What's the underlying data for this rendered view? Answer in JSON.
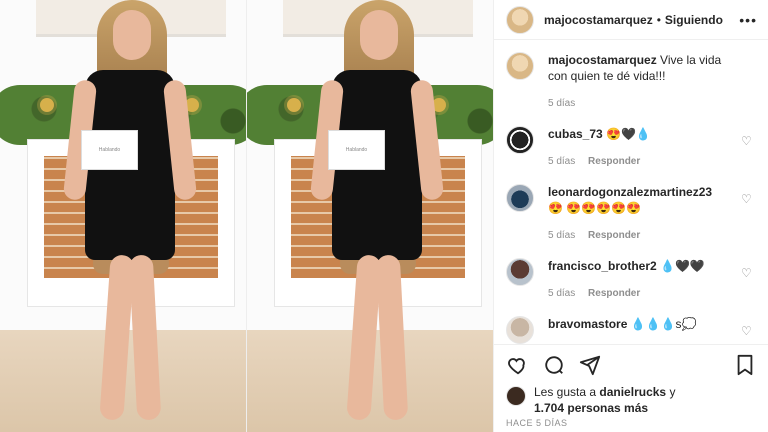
{
  "post": {
    "username": "majocostamarquez",
    "follow_label": "Siguiendo",
    "separator": "•",
    "more": "•••",
    "caption": {
      "user": "majocostamarquez",
      "text": "Vive la vida con quien te dé vida!!!",
      "time": "5 días"
    },
    "comments": [
      {
        "user": "cubas_73",
        "text": "😍🖤💧",
        "time": "5 días",
        "reply": "Responder"
      },
      {
        "user": "leonardogonzalezmartinez23",
        "text": "😍 😍😍😍😍😍",
        "time": "5 días",
        "reply": "Responder"
      },
      {
        "user": "francisco_brother2",
        "text": "💧🖤🖤",
        "time": "5 días",
        "reply": "Responder"
      },
      {
        "user": "bravomastore",
        "text": "💧💧💧s💭",
        "time": "",
        "reply": ""
      }
    ],
    "likes": {
      "prefix": "Les gusta a",
      "user": "danielrucks",
      "suffix": "y",
      "count": "1.704 personas más"
    },
    "date": "HACE 5 DÍAS",
    "photo_card_text": "Hablando"
  }
}
